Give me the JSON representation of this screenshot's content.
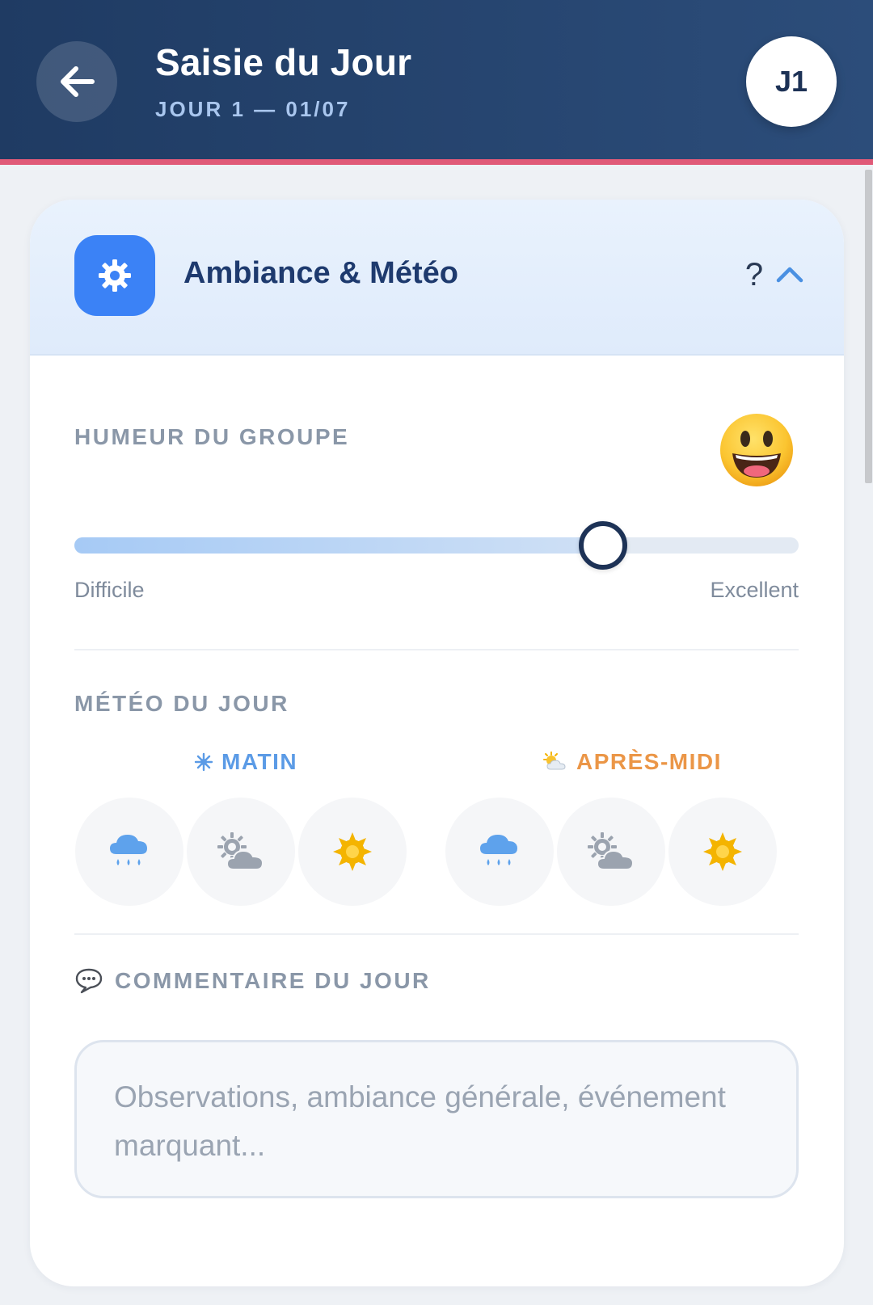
{
  "header": {
    "back_icon": "arrow-left-icon",
    "title": "Saisie du Jour",
    "subtitle": "JOUR 1 — 01/07",
    "day_badge": "J1"
  },
  "section": {
    "icon": "gear-icon",
    "title": "Ambiance & Météo",
    "help": "?",
    "collapse_icon": "chevron-up-icon",
    "accent_color": "#3b82f6"
  },
  "mood": {
    "label": "HUMEUR DU GROUPE",
    "emoji_icon": "smiling-face-icon",
    "slider_value": 0.73,
    "min_label": "Difficile",
    "max_label": "Excellent"
  },
  "weather": {
    "label": "MÉTÉO DU JOUR",
    "morning": {
      "icon": "sparkle-sun-icon",
      "label": "MATIN",
      "color": "#5b9be6",
      "options": [
        "rain-cloud-icon",
        "partly-cloudy-icon",
        "sun-icon"
      ]
    },
    "afternoon": {
      "icon": "sun-behind-cloud-icon",
      "label": "APRÈS-MIDI",
      "color": "#eb9647",
      "options": [
        "rain-cloud-icon",
        "partly-cloudy-icon",
        "sun-icon"
      ]
    }
  },
  "comment": {
    "icon": "speech-bubble-icon",
    "label": "COMMENTAIRE DU JOUR",
    "placeholder": "Observations, ambiance générale, événement marquant...",
    "value": ""
  }
}
